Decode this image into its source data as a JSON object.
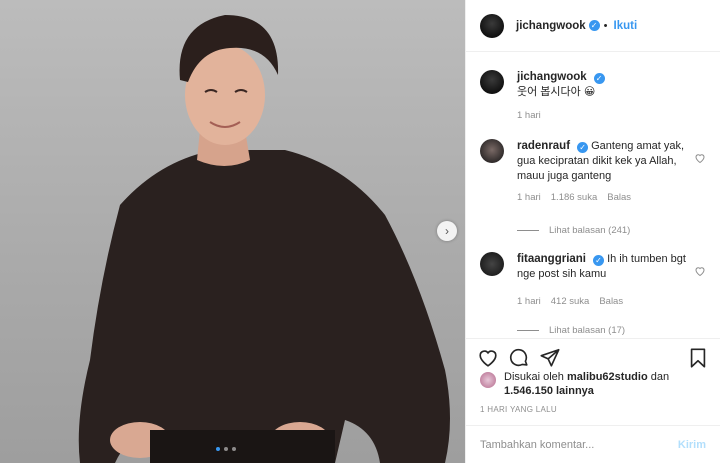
{
  "header": {
    "username": "jichangwook",
    "separator": "•",
    "follow_label": "Ikuti"
  },
  "caption": {
    "username": "jichangwook",
    "text": "웃어 봅시다아 😀",
    "time": "1 hari"
  },
  "comments": [
    {
      "username": "radenrauf",
      "verified": true,
      "text": "Ganteng amat yak, gua kecipratan dikit kek ya Allah, mauu juga ganteng",
      "time": "1 hari",
      "likes": "1.186 suka",
      "reply_label": "Balas",
      "view_replies": "Lihat balasan (241)"
    },
    {
      "username": "fitaanggriani",
      "verified": true,
      "text": "Ih ih tumben bgt nge post sih kamu",
      "time": "1 hari",
      "likes": "412 suka",
      "reply_label": "Balas",
      "view_replies": "Lihat balasan (17)"
    }
  ],
  "likes_line": {
    "prefix": "Disukai oleh",
    "user": "malibu62studio",
    "conjunction": "dan",
    "count": "1.546.150 lainnya"
  },
  "post_time": "1 HARI YANG LALU",
  "comment_box": {
    "placeholder": "Tambahkan komentar...",
    "post_label": "Kirim"
  },
  "carousel": {
    "current": 1,
    "total": 3
  },
  "icons": {
    "verified": "verified-badge-icon",
    "like": "heart-icon",
    "comment": "comment-icon",
    "share": "share-icon",
    "save": "bookmark-icon",
    "next": "chevron-right-icon"
  },
  "colors": {
    "accent": "#3897f0",
    "muted": "#8e8e8e",
    "text": "#262626",
    "post_disabled": "#b2dffc"
  }
}
